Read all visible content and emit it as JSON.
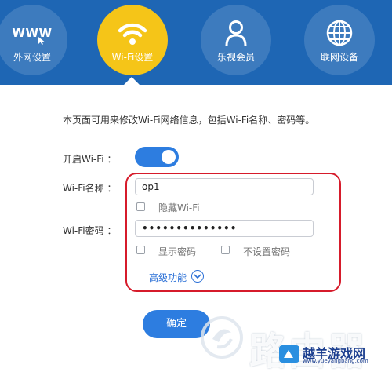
{
  "nav": {
    "items": [
      {
        "label": "外网设置",
        "icon": "www-icon",
        "active": false
      },
      {
        "label": "Wi-Fi设置",
        "icon": "wifi-icon",
        "active": true
      },
      {
        "label": "乐视会员",
        "icon": "user-icon",
        "active": false
      },
      {
        "label": "联网设备",
        "icon": "globe-icon",
        "active": false
      }
    ],
    "www_text": "WWW"
  },
  "content": {
    "description": "本页面可用来修改Wi-Fi网络信息，包括Wi-Fi名称、密码等。",
    "wifi_on_label": "开启Wi-Fi ：",
    "wifi_on": true,
    "ssid_label": "Wi-Fi名称 ：",
    "ssid_value": "op1",
    "hide_label": "隐藏Wi-Fi",
    "password_label": "Wi-Fi密码 ：",
    "password_value": "••••••••••••••",
    "show_password_label": "显示密码",
    "no_password_label": "不设置密码",
    "advanced_label": "高级功能",
    "confirm_label": "确定"
  },
  "watermark": {
    "big_text": "路由器",
    "site_name": "越羊游戏网",
    "site_url": "www.yueyangbang.com"
  },
  "colors": {
    "nav_bg": "#1e66b4",
    "active_tab": "#f5c518",
    "primary": "#2d7de0",
    "highlight_frame": "#d61b2b"
  }
}
